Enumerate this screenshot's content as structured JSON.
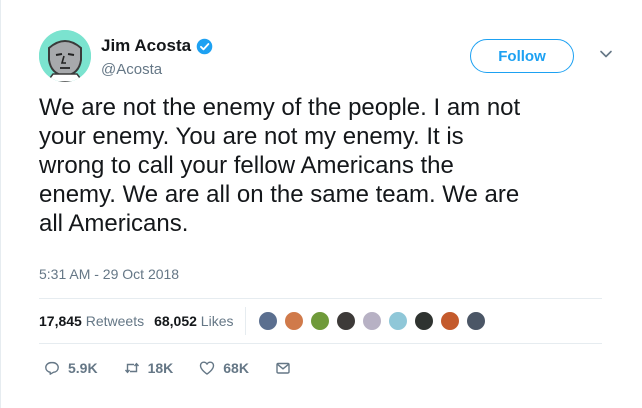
{
  "author": {
    "display_name": "Jim Acosta",
    "handle": "@Acosta",
    "verified": true
  },
  "follow_button": {
    "label": "Follow"
  },
  "tweet": {
    "text": "We are not the enemy of the people. I am not\nyour enemy. You are not my enemy. It is\nwrong to call your fellow Americans the\nenemy. We are all on the same team. We are\nall Americans.",
    "timestamp": "5:31 AM - 29 Oct 2018"
  },
  "stats": {
    "retweets_count": "17,845",
    "retweets_label": "Retweets",
    "likes_count": "68,052",
    "likes_label": "Likes"
  },
  "likers_avatar_colors": [
    "#5b6f8f",
    "#d07a4a",
    "#6f9a3a",
    "#3d3a38",
    "#b7b1c4",
    "#8fc7d8",
    "#2f3330",
    "#c45a2c",
    "#4b5666"
  ],
  "actions": {
    "replies": "5.9K",
    "retweets": "18K",
    "likes": "68K"
  },
  "colors": {
    "accent": "#1da1f2",
    "secondary_text": "#657786",
    "primary_text": "#14171a"
  }
}
